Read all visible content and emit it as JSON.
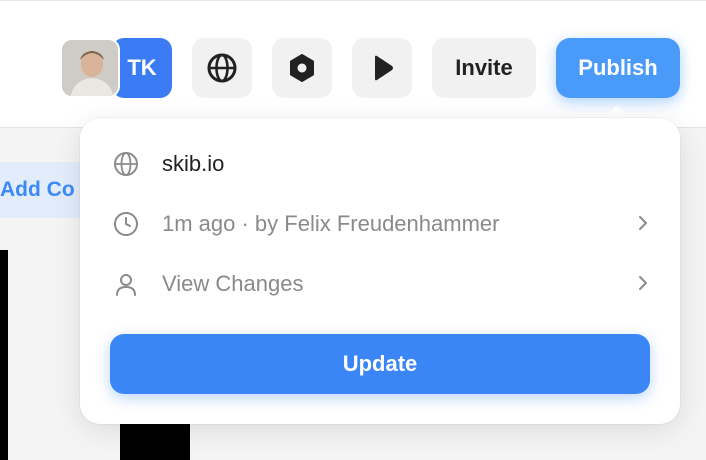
{
  "toolbar": {
    "user_initials": "TK",
    "invite_label": "Invite",
    "publish_label": "Publish"
  },
  "canvas": {
    "add_chip_label": "Add Co"
  },
  "publish_popover": {
    "site_domain": "skib.io",
    "last_published": "1m ago · by Felix Freudenhammer",
    "view_changes_label": "View Changes",
    "update_label": "Update"
  },
  "icons": {
    "globe": "globe-icon",
    "hexagon": "hexagon-icon",
    "play": "play-icon",
    "clock": "clock-icon",
    "user": "user-icon",
    "chevron": "chevron-right-icon"
  },
  "colors": {
    "accent": "#3b86f6",
    "publish": "#4a9af9",
    "avatar_tk": "#3b7cf5",
    "muted_text": "#8a8a8a"
  }
}
